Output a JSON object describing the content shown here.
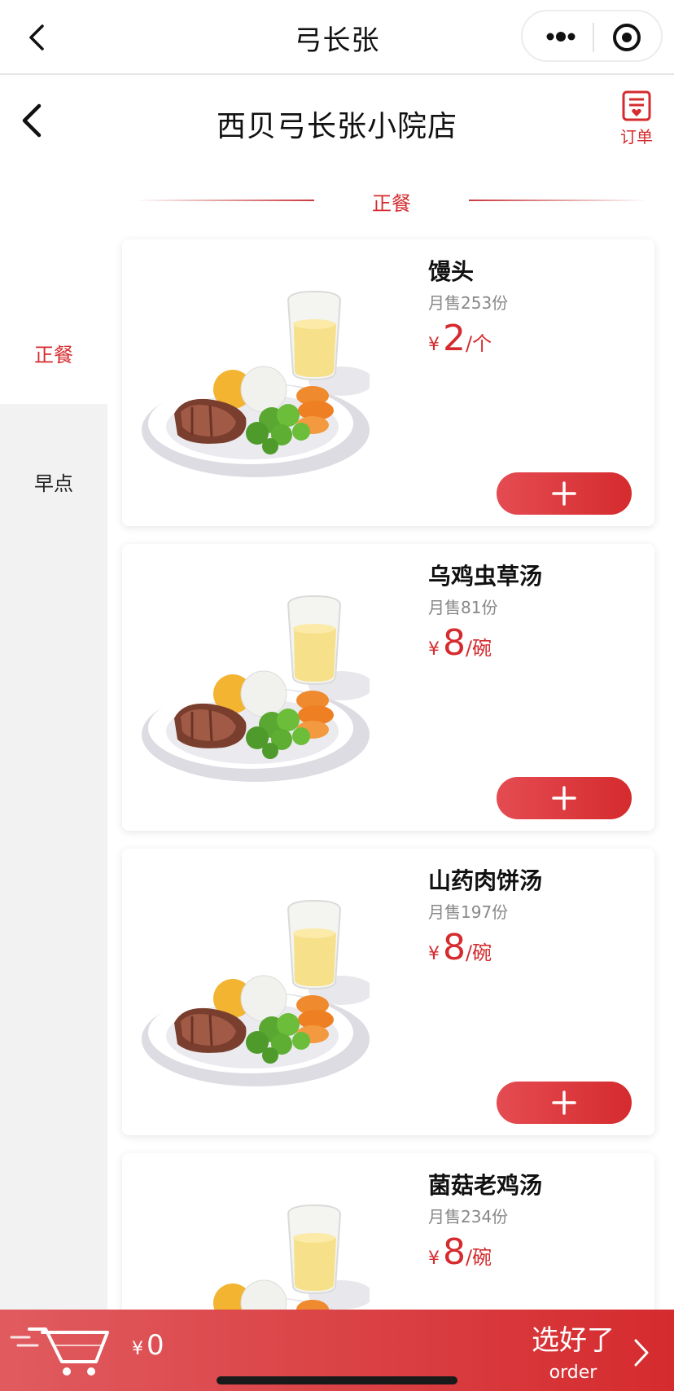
{
  "topbar": {
    "title": "弓长张"
  },
  "store": {
    "name": "西贝弓长张小院店",
    "order_label": "订单"
  },
  "section": {
    "title": "正餐"
  },
  "sidebar": {
    "items": [
      {
        "label": "正餐",
        "active": true
      },
      {
        "label": "早点",
        "active": false
      }
    ]
  },
  "items": [
    {
      "name": "馒头",
      "sold": "月售253份",
      "currency": "¥",
      "price": "2",
      "unit": "/个"
    },
    {
      "name": "乌鸡虫草汤",
      "sold": "月售81份",
      "currency": "¥",
      "price": "8",
      "unit": "/碗"
    },
    {
      "name": "山药肉饼汤",
      "sold": "月售197份",
      "currency": "¥",
      "price": "8",
      "unit": "/碗"
    },
    {
      "name": "菌菇老鸡汤",
      "sold": "月售234份",
      "currency": "¥",
      "price": "8",
      "unit": "/碗"
    }
  ],
  "cart": {
    "currency": "¥",
    "total": "0",
    "checkout_label": "选好了",
    "checkout_sub": "order"
  },
  "colors": {
    "accent": "#d52b2e",
    "sidebar_bg": "#f2f2f2"
  },
  "icons": {
    "back": "chevron-left-icon",
    "more": "more-dots-icon",
    "record": "target-icon",
    "order": "order-list-icon",
    "add": "plus-icon",
    "cart": "cart-icon",
    "next": "chevron-right-icon"
  }
}
